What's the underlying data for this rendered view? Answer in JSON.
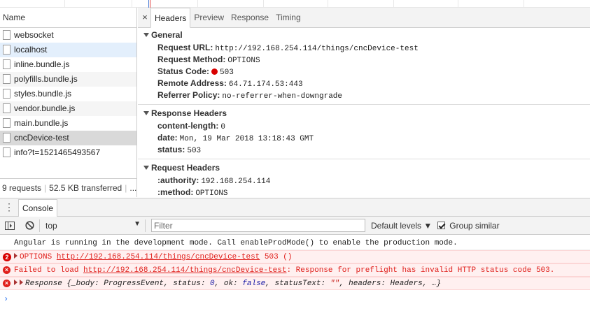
{
  "network": {
    "column_name": "Name",
    "requests": [
      "websocket",
      "localhost",
      "inline.bundle.js",
      "polyfills.bundle.js",
      "styles.bundle.js",
      "vendor.bundle.js",
      "main.bundle.js",
      "cncDevice-test",
      "info?t=1521465493567"
    ],
    "summary": {
      "requests": "9 requests",
      "transferred": "52.5 KB transferred",
      "more": "..."
    }
  },
  "details": {
    "close": "×",
    "tabs": [
      "Headers",
      "Preview",
      "Response",
      "Timing"
    ],
    "general": {
      "title": "General",
      "request_url_label": "Request URL:",
      "request_url": "http://192.168.254.114/things/cncDevice-test",
      "request_method_label": "Request Method:",
      "request_method": "OPTIONS",
      "status_code_label": "Status Code:",
      "status_code": "503",
      "remote_address_label": "Remote Address:",
      "remote_address": "64.71.174.53:443",
      "referrer_policy_label": "Referrer Policy:",
      "referrer_policy": "no-referrer-when-downgrade"
    },
    "response_headers": {
      "title": "Response Headers",
      "content_length_label": "content-length:",
      "content_length": "0",
      "date_label": "date:",
      "date": "Mon, 19 Mar 2018 13:18:43 GMT",
      "status_label": "status:",
      "status": "503"
    },
    "request_headers": {
      "title": "Request Headers",
      "authority_label": ":authority:",
      "authority": "192.168.254.114",
      "method_label": ":method:",
      "method": "OPTIONS"
    }
  },
  "console": {
    "tab": "Console",
    "context": "top",
    "filter_placeholder": "Filter",
    "levels": "Default levels ▼",
    "group_similar": "Group similar",
    "messages": {
      "info": "Angular is running in the development mode. Call enableProdMode() to enable the production mode.",
      "m1_count": "2",
      "m1_method": "OPTIONS",
      "m1_url": "http://192.168.254.114/things/cncDevice-test",
      "m1_status": "503 ()",
      "m2_prefix": "Failed to load",
      "m2_url": "http://192.168.254.114/things/cncDevice-test",
      "m2_suffix": ": Response for preflight has invalid HTTP status code 503.",
      "m3_head": "Response {_body: ProgressEvent, status: ",
      "m3_status": "0",
      "m3_mid": ", ok: ",
      "m3_ok": "false",
      "m3_mid2": ", statusText: ",
      "m3_status_text": "\"\"",
      "m3_tail": ", headers: Headers, …}"
    },
    "prompt": "›"
  },
  "colors": {
    "error": "#e0201c",
    "selected": "#d9d9d9",
    "highlight": "#e3effc",
    "status_dot": "#d80000"
  }
}
